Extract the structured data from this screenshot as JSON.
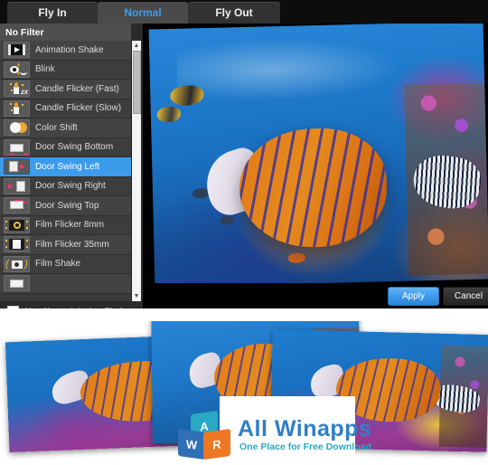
{
  "tabs": [
    {
      "label": "Fly In",
      "active": false
    },
    {
      "label": "Normal",
      "active": true
    },
    {
      "label": "Fly Out",
      "active": false
    }
  ],
  "filter_list": {
    "header": "No Filter",
    "selected": "Door Swing Left",
    "items": [
      {
        "label": "Animation Shake",
        "icon": "film-play-icon"
      },
      {
        "label": "Blink",
        "icon": "eye-blink-icon"
      },
      {
        "label": "Candle Flicker (Fast)",
        "icon": "candle-fast-icon"
      },
      {
        "label": "Candle Flicker (Slow)",
        "icon": "candle-slow-icon"
      },
      {
        "label": "Color Shift",
        "icon": "color-circles-icon"
      },
      {
        "label": "Door Swing Bottom",
        "icon": "door-swing-bottom-icon"
      },
      {
        "label": "Door Swing Left",
        "icon": "door-swing-left-icon"
      },
      {
        "label": "Door Swing Right",
        "icon": "door-swing-right-icon"
      },
      {
        "label": "Door Swing Top",
        "icon": "door-swing-top-icon"
      },
      {
        "label": "Film Flicker 8mm",
        "icon": "film-reel-8mm-icon"
      },
      {
        "label": "Film Flicker 35mm",
        "icon": "film-reel-35mm-icon"
      },
      {
        "label": "Film Shake",
        "icon": "camera-shake-icon"
      }
    ],
    "scrollbar": {
      "up_arrow": "▲",
      "down_arrow": "▼"
    }
  },
  "options": {
    "use_normal_label": "Use Normal during Fly-in and Fly-out",
    "use_normal_checked": false
  },
  "footer": {
    "apply_label": "Apply",
    "cancel_label": "Cancel"
  },
  "watermark": {
    "title": "All Winapps",
    "tagline": "One Place for Free Download",
    "cube_letters": [
      "A",
      "W",
      "R"
    ]
  },
  "colors": {
    "accent_blue": "#3d9bec",
    "panel_bg": "#2b2b2b",
    "list_row": "#434343",
    "header_row": "#4f4f4f",
    "tab_active_bg": "#4a4a4a",
    "dialog_bg": "#000000",
    "arrow_pink": "#e8376f",
    "watermark_blue": "#2f7fc9",
    "watermark_teal": "#2aa8c4",
    "watermark_orange": "#ef7622"
  }
}
